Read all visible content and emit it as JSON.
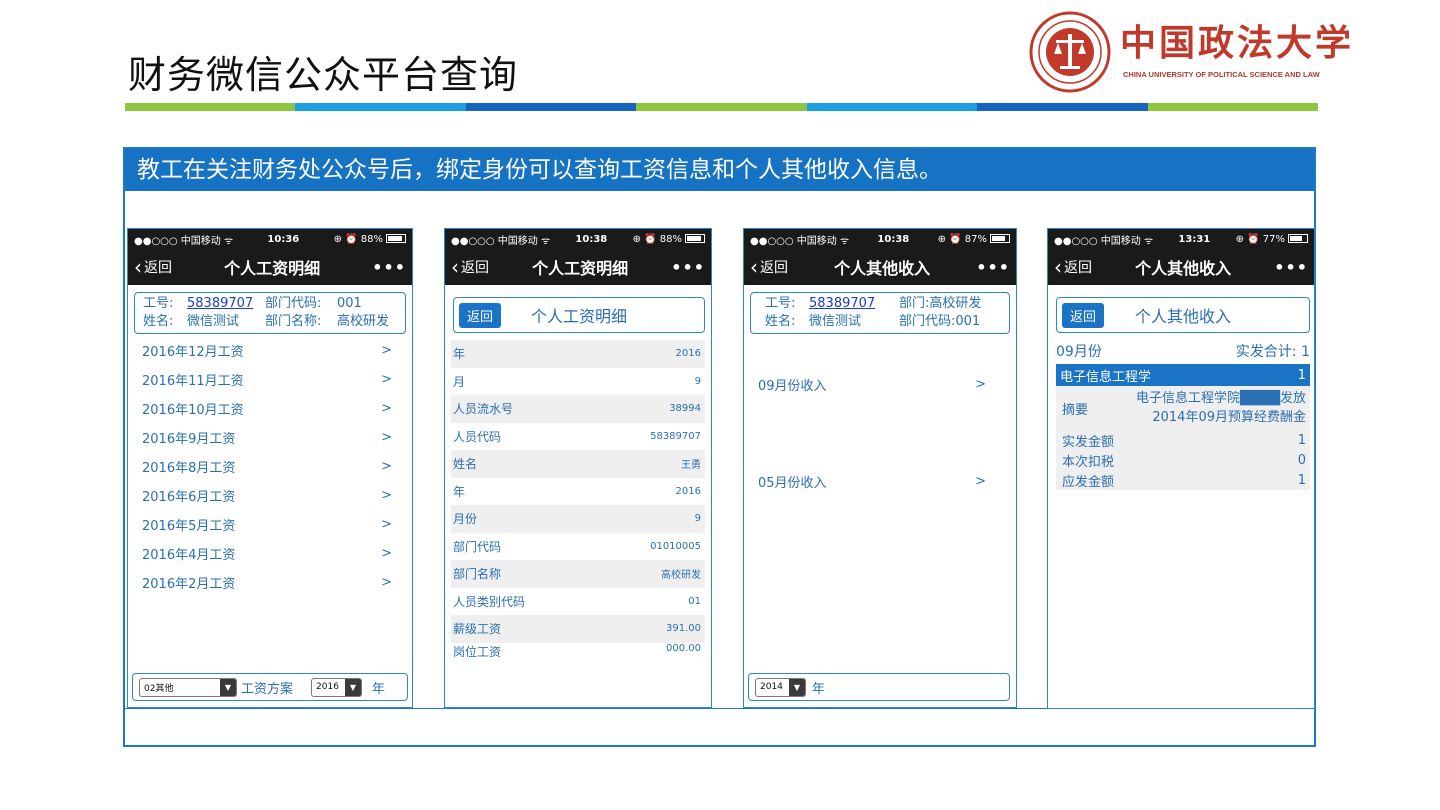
{
  "slide": {
    "title": "财务微信公众平台查询",
    "stripe_colors": [
      "#8dc63f",
      "#1ba1e2",
      "#1565c0",
      "#8dc63f",
      "#1ba1e2",
      "#1565c0",
      "#8dc63f"
    ],
    "banner": "教工在关注财务处公众号后，绑定身份可以查询工资信息和个人其他收入信息。"
  },
  "logo": {
    "name": "中国政法大学",
    "subtitle": "CHINA UNIVERSITY OF POLITICAL SCIENCE AND LAW",
    "color": "#c0392b"
  },
  "phones": [
    {
      "status": {
        "carrier": "●●○○○ 中国移动 ᯤ",
        "time": "10:36",
        "battery": "⊕ ⏰ 88%",
        "battery_level": 88
      },
      "nav": {
        "back": "返回",
        "title": "个人工资明细",
        "more": "•••"
      },
      "info": {
        "id_label": "工号:",
        "id_value": "58389707",
        "dept_code_label": "部门代码:",
        "dept_code_value": "001",
        "name_label": "姓名:",
        "name_value": "微信测试",
        "dept_name_label": "部门名称:",
        "dept_name_value": "高校研发"
      },
      "items": [
        "2016年12月工资",
        "2016年11月工资",
        "2016年10月工资",
        "2016年9月工资",
        "2016年8月工资",
        "2016年6月工资",
        "2016年5月工资",
        "2016年4月工资",
        "2016年2月工资"
      ],
      "arrow": ">",
      "footer": {
        "select1": "02其他",
        "label1": "工资方案",
        "select2": "2016",
        "label2": "年"
      }
    },
    {
      "status": {
        "carrier": "●●○○○ 中国移动 ᯤ",
        "time": "10:38",
        "battery": "⊕ ⏰ 88%",
        "battery_level": 88
      },
      "nav": {
        "back": "返回",
        "title": "个人工资明细",
        "more": "•••"
      },
      "head": {
        "button": "返回",
        "title": "个人工资明细"
      },
      "rows": [
        {
          "k": "年",
          "v": "2016"
        },
        {
          "k": "月",
          "v": "9"
        },
        {
          "k": "人员流水号",
          "v": "38994"
        },
        {
          "k": "人员代码",
          "v": "58389707"
        },
        {
          "k": "姓名",
          "v": "王勇"
        },
        {
          "k": "年",
          "v": "2016"
        },
        {
          "k": "月份",
          "v": "9"
        },
        {
          "k": "部门代码",
          "v": "01010005"
        },
        {
          "k": "部门名称",
          "v": "高校研发"
        },
        {
          "k": "人员类别代码",
          "v": "01"
        },
        {
          "k": "薪级工资",
          "v": "391.00"
        },
        {
          "k": "岗位工资",
          "v": "000.00"
        }
      ]
    },
    {
      "status": {
        "carrier": "●●○○○ 中国移动 ᯤ",
        "time": "10:38",
        "battery": "⊕ ⏰ 87%",
        "battery_level": 87
      },
      "nav": {
        "back": "返回",
        "title": "个人其他收入",
        "more": "•••"
      },
      "info": {
        "id_label": "工号:",
        "id_value": "58389707",
        "dept_label": "部门:",
        "dept_value": "高校研发",
        "name_label": "姓名:",
        "name_value": "微信测试",
        "dept_code_label": "部门代码:",
        "dept_code_value": "001"
      },
      "items": [
        "09月份收入",
        "05月份收入"
      ],
      "arrow": ">",
      "footer": {
        "select1": "2014",
        "label1": "年"
      }
    },
    {
      "status": {
        "carrier": "●●○○○ 中国移动 ᯤ",
        "time": "13:31",
        "battery": "⊕ ⏰ 77%",
        "battery_level": 77
      },
      "nav": {
        "back": "返回",
        "title": "个人其他收入",
        "more": "•••"
      },
      "head": {
        "button": "返回",
        "title": "个人其他收入"
      },
      "summary": {
        "month": "09月份",
        "total_label": "实发合计:",
        "total_value": "1"
      },
      "bar": {
        "label": "电子信息工程学",
        "value": "1"
      },
      "summary_row": {
        "label": "摘要",
        "line1": "电子信息工程学院████发放",
        "line2": "2014年09月预算经费酬金"
      },
      "rows": [
        {
          "k": "实发金额",
          "v": "1"
        },
        {
          "k": "本次扣税",
          "v": "0"
        },
        {
          "k": "应发金额",
          "v": "1"
        }
      ]
    }
  ]
}
